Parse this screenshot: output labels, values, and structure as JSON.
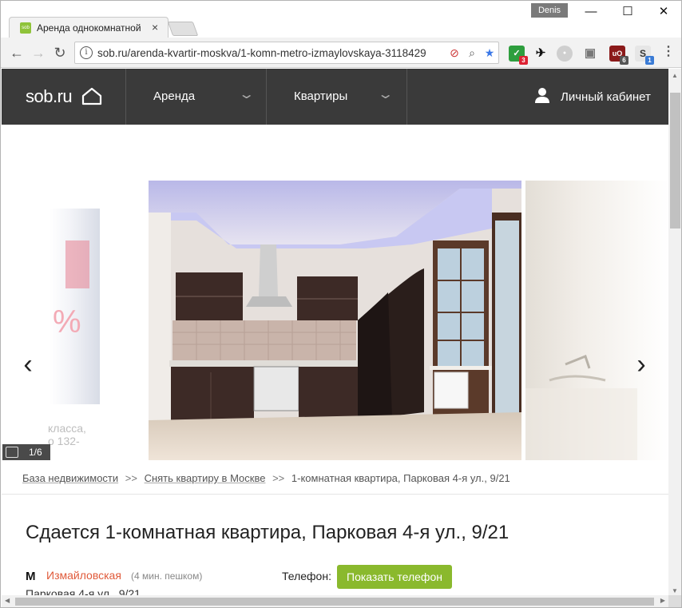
{
  "browser": {
    "tab_title": "Аренда однокомнатной",
    "tab_favicon_text": "sob",
    "tab_close": "×",
    "profile_name": "Denis",
    "url": "sob.ru/arenda-kvartir-moskva/1-komn-metro-izmaylovskaya-3118429",
    "window_controls": {
      "minimize": "—",
      "maximize": "☐",
      "close": "✕"
    },
    "nav": {
      "back": "←",
      "forward": "→",
      "reload": "↻"
    },
    "extensions": [
      {
        "name": "checklist-extension",
        "badge": "3",
        "color": "#2e9e3e",
        "badge_color": "#d23"
      },
      {
        "name": "bird-extension",
        "badge": "",
        "color": "#ffffff",
        "badge_color": ""
      },
      {
        "name": "circle-extension",
        "badge": "",
        "color": "#cccccc",
        "badge_color": ""
      },
      {
        "name": "camera-extension",
        "badge": "",
        "color": "#ffffff",
        "badge_color": ""
      },
      {
        "name": "ublock-extension",
        "badge": "6",
        "color": "#8b1a1a",
        "badge_color": "#555"
      },
      {
        "name": "s-extension",
        "badge": "1",
        "color": "#e6e6e6",
        "badge_color": "#3a7bd5"
      }
    ],
    "ublock_text": "uO",
    "s_text": "S"
  },
  "site": {
    "logo": "sob.ru",
    "nav": [
      {
        "label": "Аренда"
      },
      {
        "label": "Квартиры"
      }
    ],
    "cabinet_label": "Личный кабинет",
    "accent_green": "#8ab92d",
    "metro_red": "#e05a3a"
  },
  "gallery": {
    "counter": "1/6",
    "prev": "‹",
    "next": "›",
    "left_caption_line1": "класса,",
    "left_caption_line2": "о 132-",
    "left_promo_text": "%"
  },
  "breadcrumb": {
    "items": [
      "База недвижимости",
      "Снять квартиру в Москве"
    ],
    "separator": ">>",
    "current": "1-комнатная квартира, Парковая 4-я ул., 9/21"
  },
  "listing": {
    "title": "Сдается 1-комнатная квартира, Парковая 4-я ул., 9/21",
    "metro_symbol": "M",
    "metro": "Измайловская",
    "walk": "(4 мин. пешком)",
    "address": "Парковая 4-я ул., 9/21",
    "phone_label": "Телефон:",
    "phone_button": "Показать телефон"
  }
}
